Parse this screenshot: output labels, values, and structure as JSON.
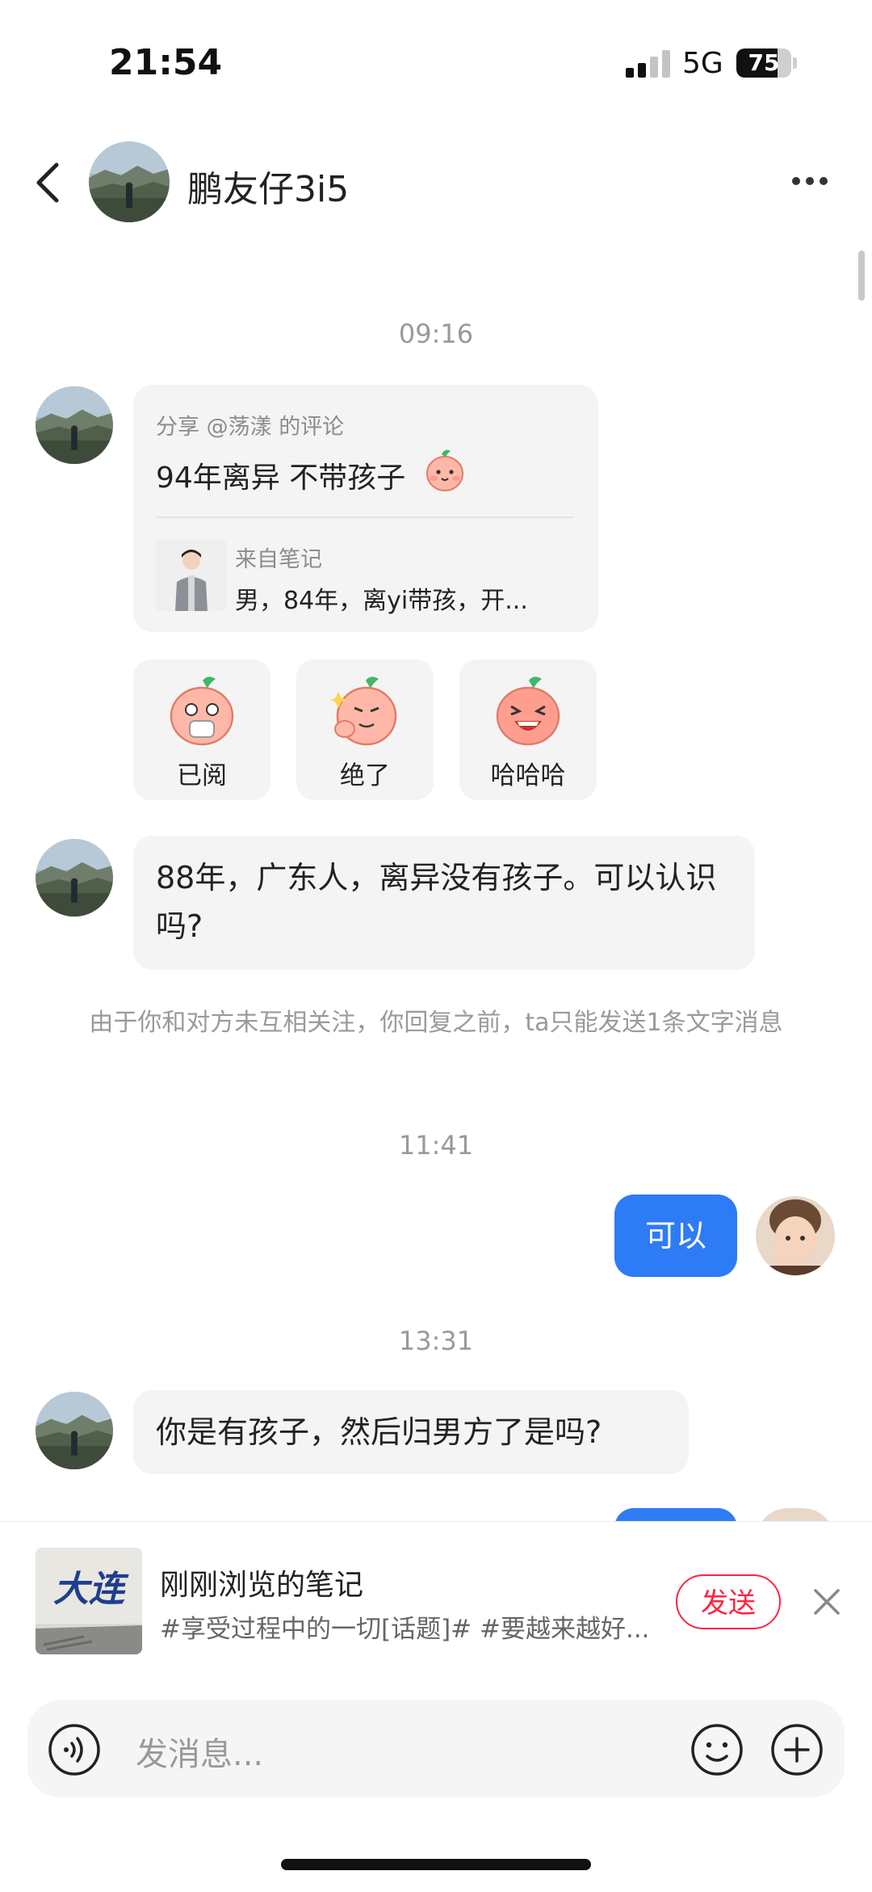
{
  "status_bar": {
    "time": "21:54",
    "network": "5G",
    "battery": "75"
  },
  "header": {
    "title": "鹏友仔3i5"
  },
  "messages": {
    "stamp1": "09:16",
    "share": {
      "from_prefix": "分享",
      "mention": "@荡漾",
      "from_suffix": "的评论",
      "text": "94年离异 不带孩子",
      "note_source": "来自笔记",
      "note_title": "男，84年，离yi带孩，开..."
    },
    "reactions": [
      {
        "label": "已阅"
      },
      {
        "label": "绝了"
      },
      {
        "label": "哈哈哈"
      }
    ],
    "incoming1": "88年，广东人，离异没有孩子。可以认识吗?",
    "notice": "由于你和对方未互相关注，你回复之前，ta只能发送1条文字消息",
    "stamp2": "11:41",
    "outgoing1": "可以",
    "stamp3": "13:31",
    "incoming2": "你是有孩子，然后归男方了是吗?"
  },
  "recent_note": {
    "title": "刚刚浏览的笔记",
    "subtitle": "#享受过程中的一切[话题]# #要越来越好...",
    "thumb_text": "大连",
    "send_label": "发送"
  },
  "input": {
    "placeholder": "发消息..."
  },
  "colors": {
    "accent_blue": "#2d7cf6",
    "send_red": "#ff2442"
  },
  "icons": [
    "back-icon",
    "more-icon",
    "voice-icon",
    "emoji-icon",
    "plus-icon",
    "close-icon"
  ]
}
